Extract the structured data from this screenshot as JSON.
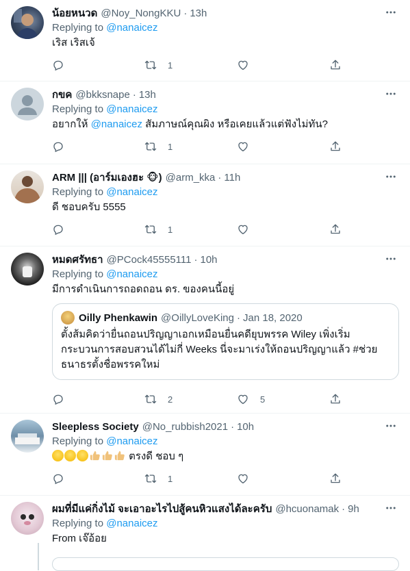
{
  "replying_label": "Replying to",
  "tweets": [
    {
      "name": "น้อยหนวด",
      "handle": "@Noy_NongKKU",
      "time": "13h",
      "reply_to": "@nanaicez",
      "text": "เริส เริสเจ้",
      "retweets": "1",
      "likes": ""
    },
    {
      "name": "กขค",
      "handle": "@bkksnape",
      "time": "13h",
      "reply_to": "@nanaicez",
      "text_pre": "อยากให้ ",
      "text_mention": "@nanaicez",
      "text_post": " สัมภาษณ์คุณผิง หรือเคยแล้วแต่ฟังไม่ทัน?",
      "retweets": "1",
      "likes": ""
    },
    {
      "name": "ARM ||| (อาร์มเองฮะ 🐵)",
      "handle": "@arm_kka",
      "time": "11h",
      "reply_to": "@nanaicez",
      "text": "ดี ชอบครับ 5555",
      "retweets": "1",
      "likes": ""
    },
    {
      "name": "หมดศรัทธา",
      "handle": "@PCock45555111",
      "time": "10h",
      "reply_to": "@nanaicez",
      "text": "มีการดำเนินการถอดถอน ดร. ของคนนี้อยู่",
      "quote": {
        "name": "Oilly Phenkawin",
        "handle": "@OillyLoveKing",
        "date": "Jan 18, 2020",
        "text": "ตั้งส้มคิดว่ายื่นถอนปริญญาเอกเหมือนยื่นคดียุบพรรค Wiley เพิ่งเริ่มกระบวนการสอบสวนได้ไม่กี่ Weeks นี่จะมาเร่งให้ถอนปริญญาแล้ว #ช่วยธนาธรตั้งชื่อพรรคใหม่"
      },
      "retweets": "2",
      "likes": "5"
    },
    {
      "name": "Sleepless Society",
      "handle": "@No_rubbish2021",
      "time": "10h",
      "reply_to": "@nanaicez",
      "text": " ตรงดี ชอบ ๆ",
      "retweets": "1",
      "likes": ""
    },
    {
      "name": "ผมที่มีแค่กิ่งไม้ จะเอาอะไรไปสู้คนหิวแสงได้ละครับ",
      "handle": "@hcuonamak",
      "time": "9h",
      "reply_to": "@nanaicez",
      "text": "From เจ๊อ้อย"
    }
  ],
  "icons": {
    "more": "more-icon",
    "reply": "reply-icon",
    "retweet": "retweet-icon",
    "like": "like-icon",
    "share": "share-icon"
  },
  "colors": {
    "accent": "#1d9bf0",
    "secondary_text": "#536471",
    "divider": "#eff3f4"
  }
}
